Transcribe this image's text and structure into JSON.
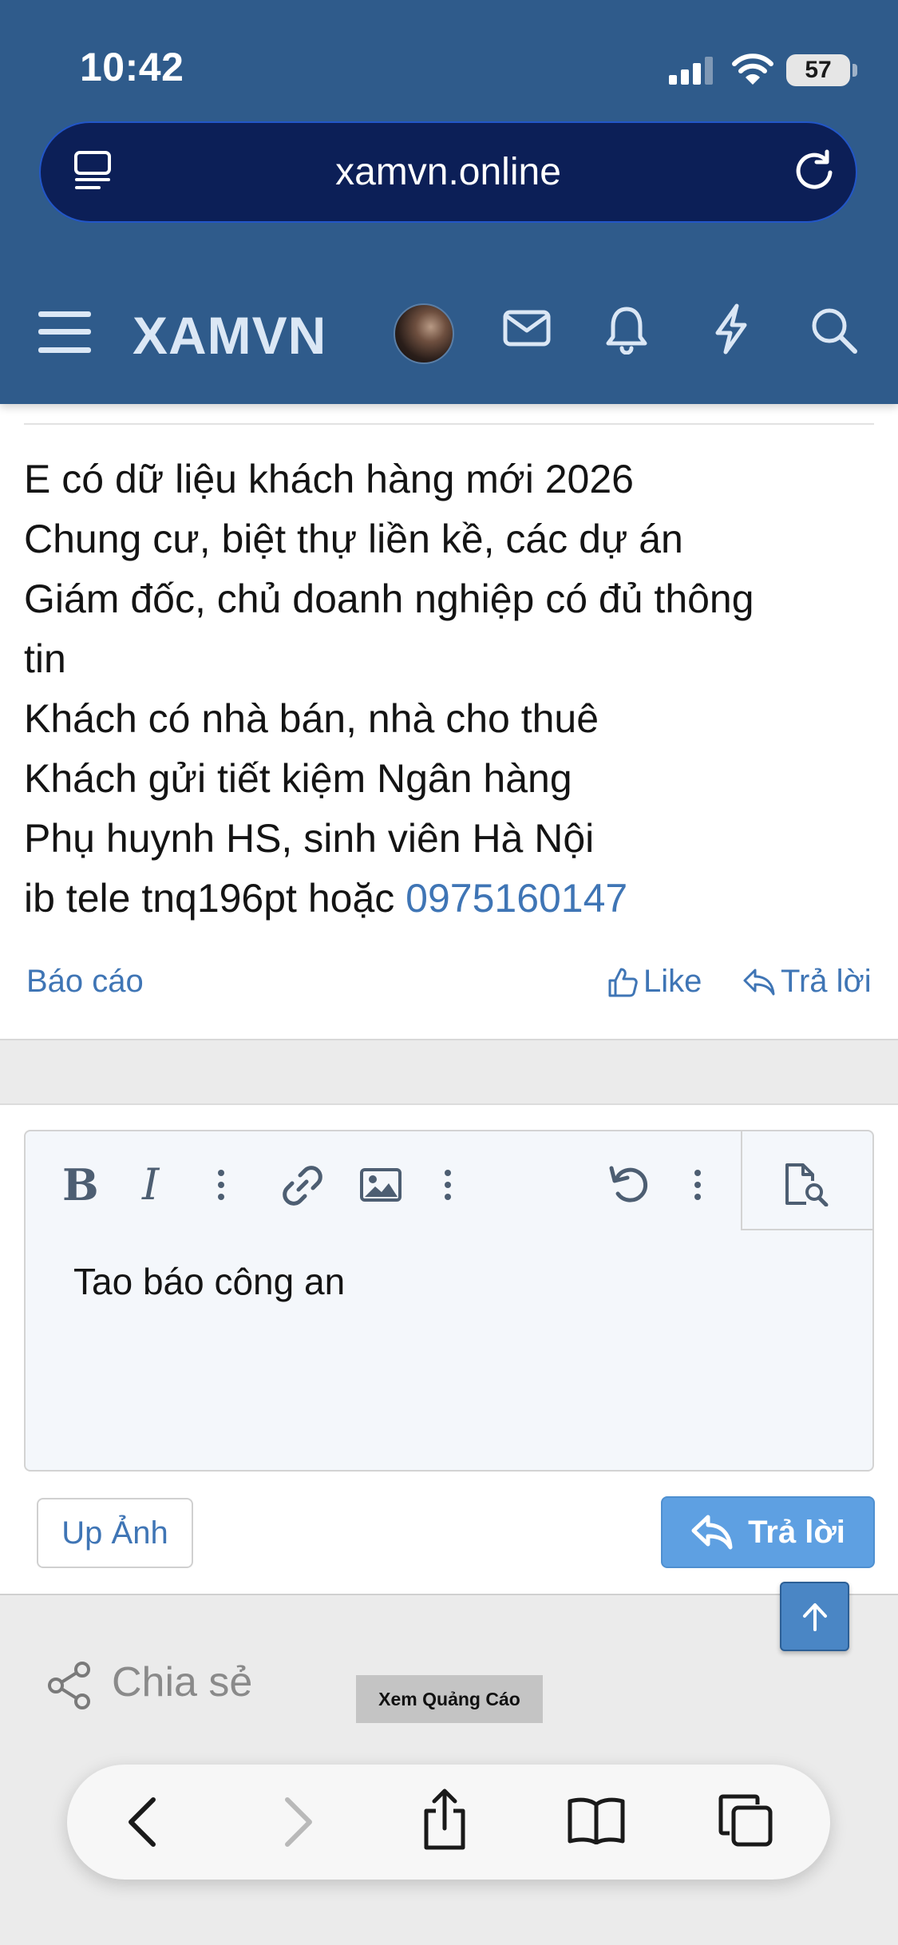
{
  "status_bar": {
    "time": "10:42",
    "battery": "57"
  },
  "browser": {
    "url": "xamvn.online"
  },
  "site_nav": {
    "logo": "XAMVN"
  },
  "post": {
    "lines": [
      "E có dữ liệu khách hàng mới 2026",
      "Chung cư, biệt thự liền kề, các dự án",
      "Giám đốc, chủ doanh nghiệp có đủ thông",
      "tin",
      "Khách có nhà bán, nhà cho thuê",
      "Khách gửi tiết kiệm Ngân hàng",
      "Phụ huynh HS, sinh viên Hà Nội"
    ],
    "last_line_prefix": "ib tele tnq196pt hoặc ",
    "phone": "0975160147",
    "actions": {
      "report": "Báo cáo",
      "like": "Like",
      "reply": "Trả lời"
    }
  },
  "reply_form": {
    "editor_text": "Tao báo công an",
    "upload_label": "Up Ảnh",
    "submit_label": "Trả lời"
  },
  "footer": {
    "share_label": "Chia sẻ",
    "ad_label": "Xem Quảng Cáo"
  },
  "colors": {
    "header_bg": "#2f5b8b",
    "url_bar_bg": "#0c1f57",
    "link": "#3f75b5",
    "reply_button": "#5ea0e2"
  }
}
